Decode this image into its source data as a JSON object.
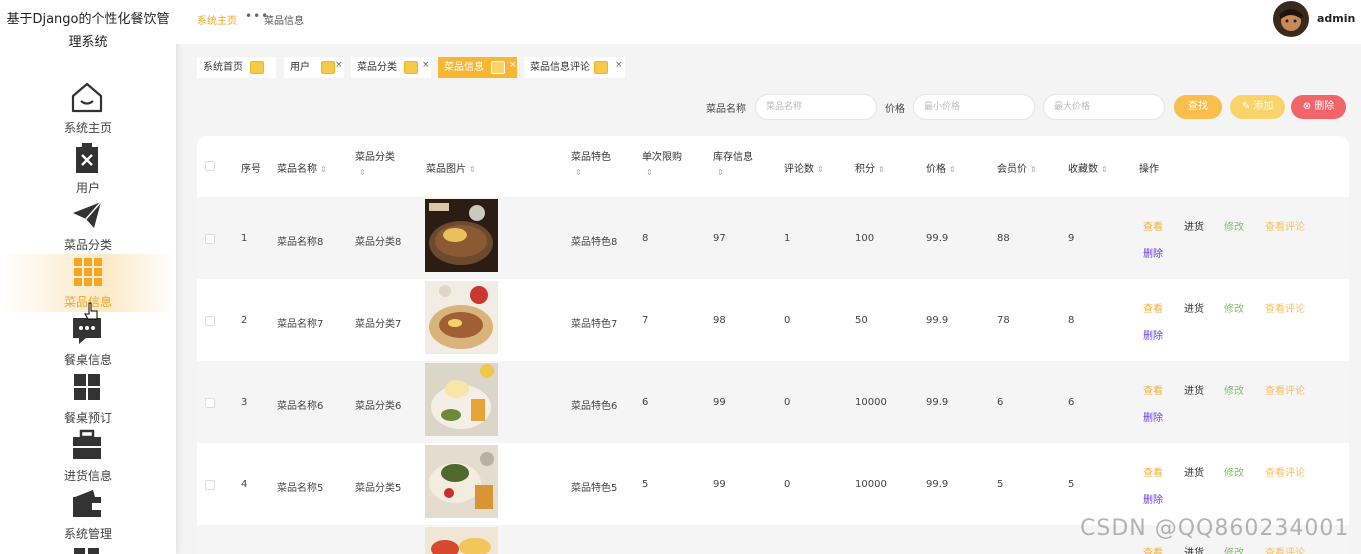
{
  "app": {
    "title": "基于Django的个性化餐饮管理系统"
  },
  "sidebar": {
    "items": [
      {
        "label": "系统主页",
        "icon": "home-icon"
      },
      {
        "label": "用户",
        "icon": "user-icon"
      },
      {
        "label": "菜品分类",
        "icon": "paper-plane-icon"
      },
      {
        "label": "菜品信息",
        "icon": "grid-icon",
        "active": true
      },
      {
        "label": "餐桌信息",
        "icon": "chat-icon"
      },
      {
        "label": "餐桌预订",
        "icon": "blocks-icon"
      },
      {
        "label": "进货信息",
        "icon": "briefcase-icon"
      },
      {
        "label": "系统管理",
        "icon": "wallet-icon"
      }
    ]
  },
  "header": {
    "breadcrumb_home": "系统主页",
    "breadcrumb_sep": "•••",
    "breadcrumb_current": "菜品信息",
    "username": "admin"
  },
  "tabs": [
    {
      "label": "系统首页"
    },
    {
      "label": "用户"
    },
    {
      "label": "菜品分类"
    },
    {
      "label": "菜品信息"
    },
    {
      "label": "菜品信息评论"
    }
  ],
  "tab_close": "×",
  "search": {
    "name_label": "菜品名称",
    "name_placeholder": "菜品名称",
    "price_label": "价格",
    "min_placeholder": "最小价格",
    "max_placeholder": "最大价格",
    "find_label": "查找",
    "add_label": "添加",
    "delete_label": "删除"
  },
  "table": {
    "headers": {
      "index": "序号",
      "name": "菜品名称",
      "category": "菜品分类",
      "image": "菜品图片",
      "feature": "菜品特色",
      "limit": "单次限购",
      "stock": "库存信息",
      "comments": "评论数",
      "points": "积分",
      "price": "价格",
      "member_price": "会员价",
      "favorites": "收藏数",
      "actions": "操作"
    },
    "sort_icon": "⇕",
    "actions": {
      "view": "查看",
      "restock": "进货",
      "edit": "修改",
      "view_comments": "查看评论",
      "delete": "删除"
    },
    "rows": [
      {
        "index": "1",
        "name": "菜品名称8",
        "category": "菜品分类8",
        "feature": "菜品特色8",
        "limit": "8",
        "stock": "97",
        "comments": "1",
        "points": "100",
        "price": "99.9",
        "member_price": "88",
        "favorites": "9"
      },
      {
        "index": "2",
        "name": "菜品名称7",
        "category": "菜品分类7",
        "feature": "菜品特色7",
        "limit": "7",
        "stock": "98",
        "comments": "0",
        "points": "50",
        "price": "99.9",
        "member_price": "78",
        "favorites": "8"
      },
      {
        "index": "3",
        "name": "菜品名称6",
        "category": "菜品分类6",
        "feature": "菜品特色6",
        "limit": "6",
        "stock": "99",
        "comments": "0",
        "points": "10000",
        "price": "99.9",
        "member_price": "6",
        "favorites": "6"
      },
      {
        "index": "4",
        "name": "菜品名称5",
        "category": "菜品分类5",
        "feature": "菜品特色5",
        "limit": "5",
        "stock": "99",
        "comments": "0",
        "points": "10000",
        "price": "99.9",
        "member_price": "5",
        "favorites": "5"
      },
      {
        "index": "",
        "name": "",
        "category": "",
        "feature": "",
        "limit": "",
        "stock": "",
        "comments": "",
        "points": "",
        "price": "",
        "member_price": "",
        "favorites": ""
      }
    ]
  },
  "watermark": "CSDN @QQ860234001",
  "colors": {
    "accent": "#f5a623",
    "danger": "#f0646a",
    "purple": "#6a3de8",
    "green": "#7fc36c"
  }
}
